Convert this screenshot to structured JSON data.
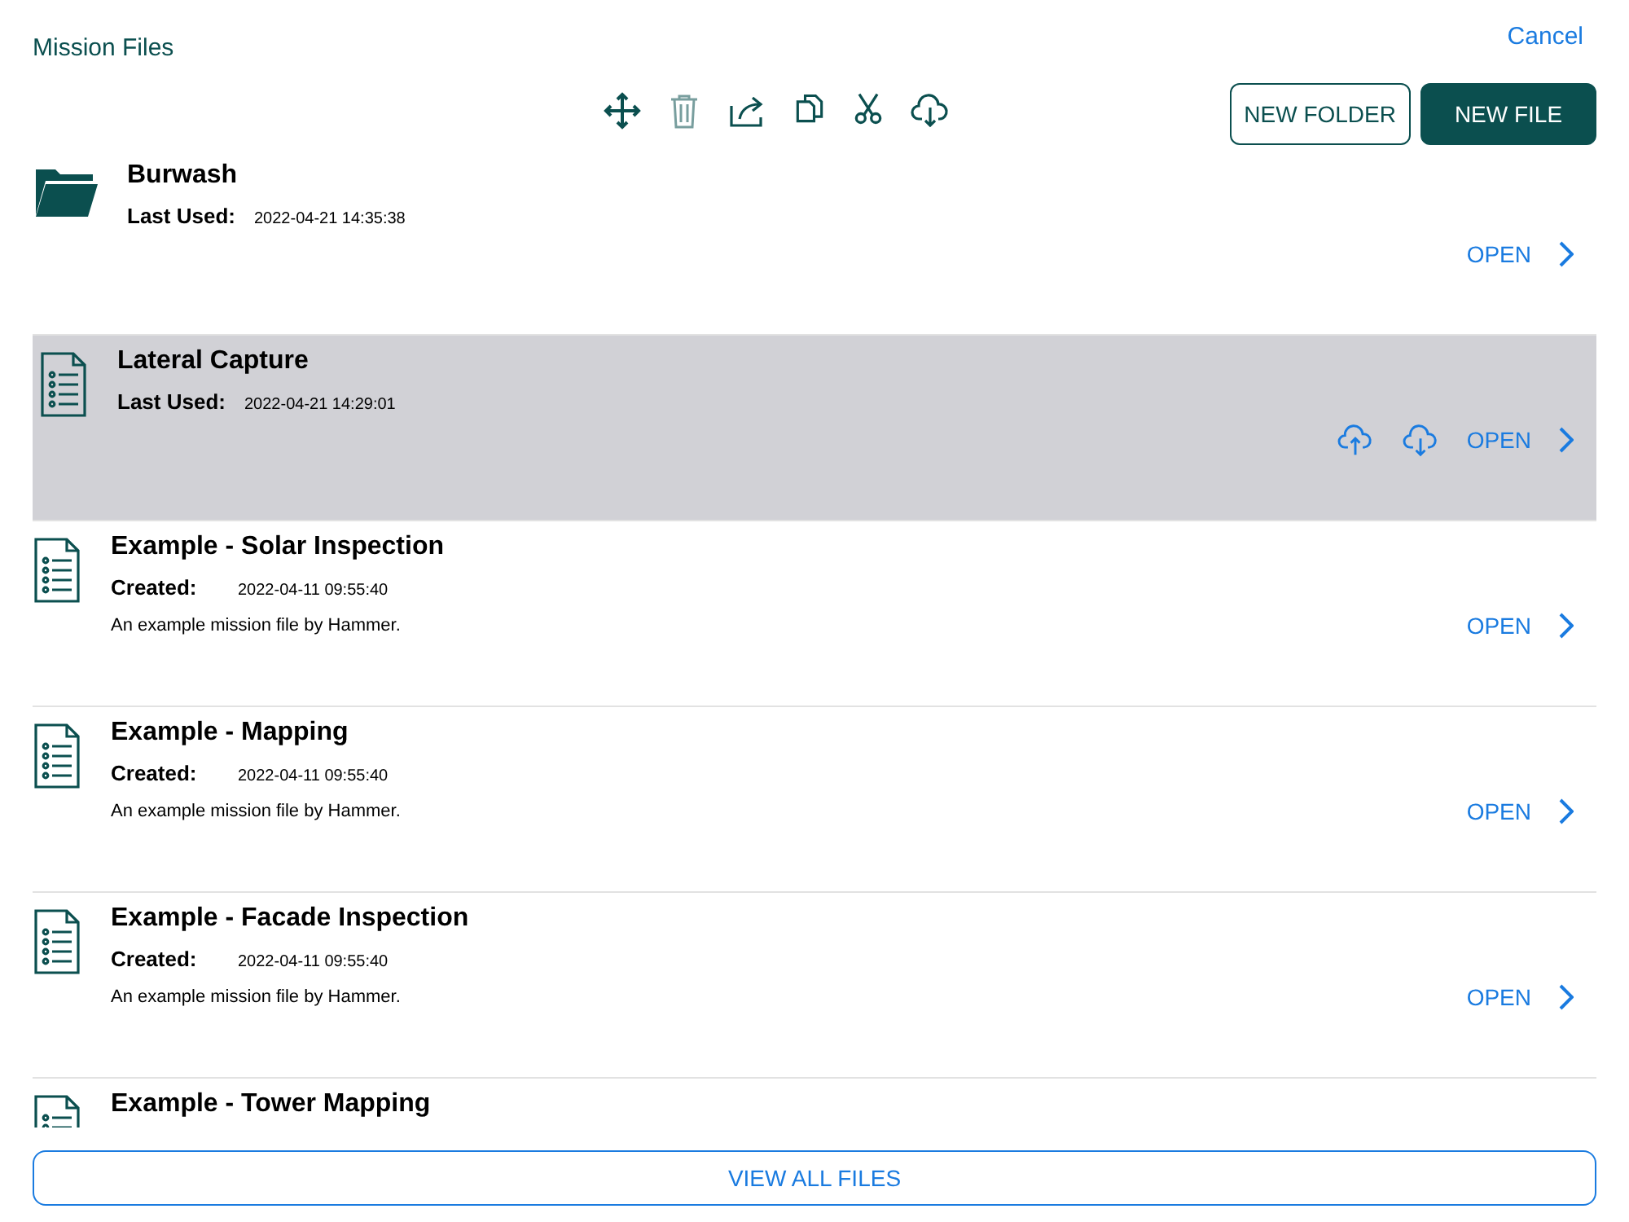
{
  "header": {
    "title": "Mission Files",
    "cancel": "Cancel"
  },
  "toolbar": [
    {
      "kind": "move",
      "disabled": false
    },
    {
      "kind": "trash",
      "disabled": true
    },
    {
      "kind": "share",
      "disabled": false
    },
    {
      "kind": "copy",
      "disabled": false
    },
    {
      "kind": "cut",
      "disabled": false
    },
    {
      "kind": "download",
      "disabled": false
    }
  ],
  "buttons": {
    "new_folder": "NEW FOLDER",
    "new_file": "NEW FILE"
  },
  "files": [
    {
      "kind": "folder",
      "name": "Burwash",
      "date_label": "Last Used:",
      "date": "2022-04-21 14:35:38",
      "selected": false,
      "cloud_actions": false,
      "open": "OPEN"
    },
    {
      "kind": "file",
      "name": "Lateral Capture",
      "date_label": "Last Used:",
      "date": "2022-04-21 14:29:01",
      "selected": true,
      "cloud_actions": true,
      "open": "OPEN"
    },
    {
      "kind": "file",
      "name": "Example - Solar Inspection",
      "date_label": "Created:",
      "date": "2022-04-11 09:55:40",
      "description": "An example mission file by Hammer.",
      "selected": false,
      "cloud_actions": false,
      "open": "OPEN"
    },
    {
      "kind": "file",
      "name": "Example - Mapping",
      "date_label": "Created:",
      "date": "2022-04-11 09:55:40",
      "description": "An example mission file by Hammer.",
      "selected": false,
      "cloud_actions": false,
      "open": "OPEN"
    },
    {
      "kind": "file",
      "name": "Example - Facade Inspection",
      "date_label": "Created:",
      "date": "2022-04-11 09:55:40",
      "description": "An example mission file by Hammer.",
      "selected": false,
      "cloud_actions": false,
      "open": "OPEN"
    },
    {
      "kind": "file",
      "name": "Example - Tower Mapping",
      "selected": false
    }
  ],
  "view_all": "VIEW ALL FILES"
}
